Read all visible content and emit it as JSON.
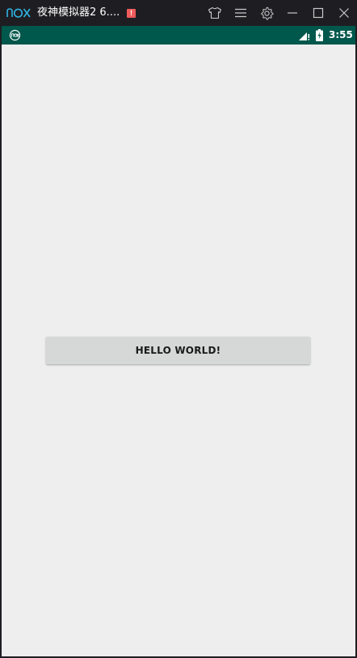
{
  "window": {
    "title": "夜神模拟器2 6....",
    "alert_badge": "!",
    "logo_text": "nox",
    "controls": {
      "skin_icon": "shirt-icon",
      "menu_icon": "hamburger-menu-icon",
      "settings_icon": "gear-icon",
      "minimize_icon": "minimize-icon",
      "maximize_icon": "maximize-icon",
      "close_icon": "close-icon"
    }
  },
  "status_bar": {
    "time": "3:55",
    "icons": [
      "nox-notification-icon",
      "signal-icon",
      "battery-charging-icon"
    ],
    "color": "#00574b"
  },
  "app": {
    "button_label": "HELLO WORLD!",
    "background": "#eeeeee"
  }
}
